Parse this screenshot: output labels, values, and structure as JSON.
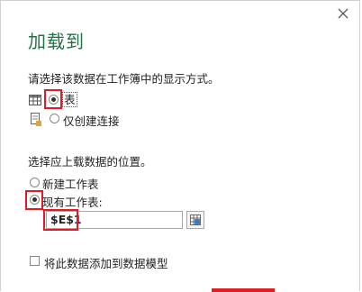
{
  "dialog": {
    "title": "加载到",
    "view_prompt": "请选择该数据在工作簿中的显示方式。",
    "view_options": [
      {
        "label": "表",
        "selected": true
      },
      {
        "label": "仅创建连接",
        "selected": false
      }
    ],
    "location_prompt": "选择应上载数据的位置。",
    "location_options": [
      {
        "label": "新建工作表",
        "selected": false
      },
      {
        "label": "现有工作表:",
        "selected": true
      }
    ],
    "cell_reference": "$E$1",
    "data_model_label": "将此数据添加到数据模型",
    "colors": {
      "accent": "#217346",
      "highlight": "#e01b24"
    },
    "icons": [
      "close-icon",
      "table-icon",
      "connection-icon",
      "range-picker-icon"
    ]
  }
}
